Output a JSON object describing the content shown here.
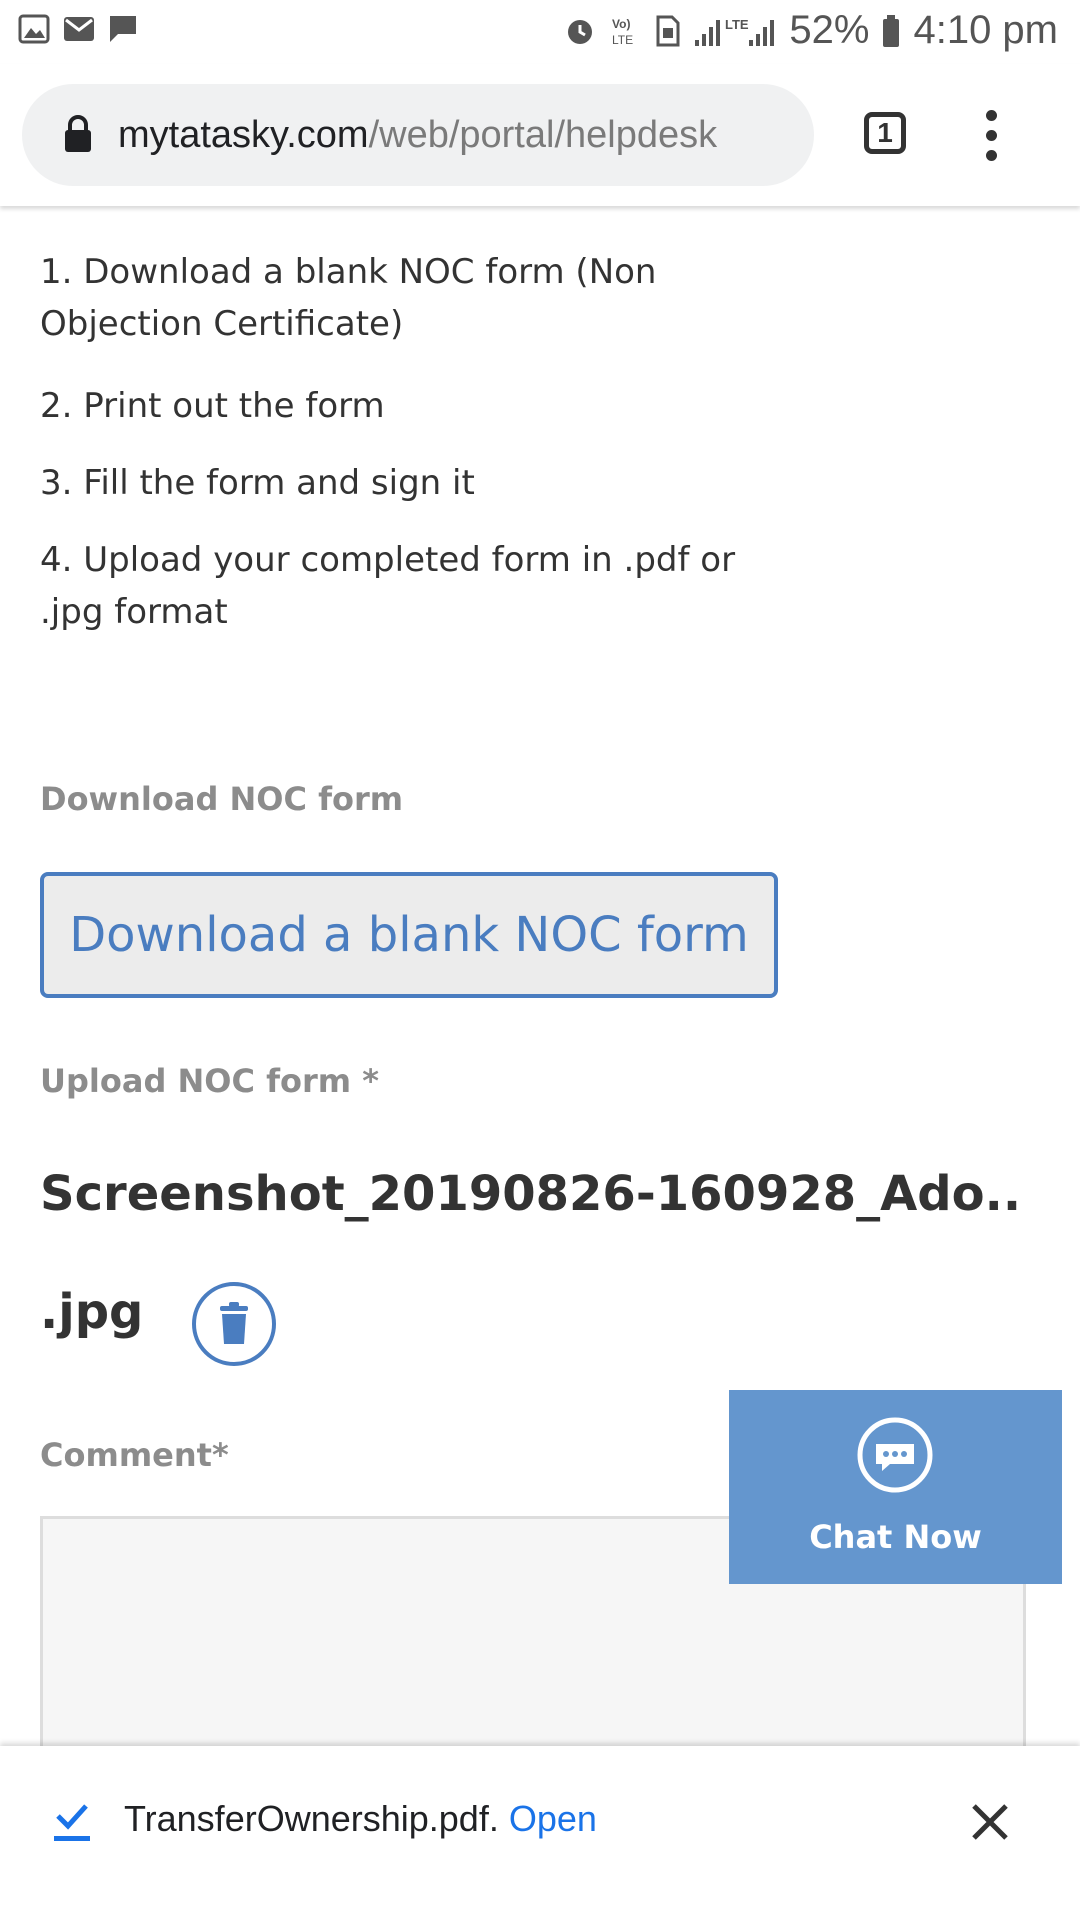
{
  "status_bar": {
    "battery": "52%",
    "time": "4:10 pm",
    "network": "LTE",
    "icons": [
      "image-icon",
      "mail-icon",
      "message-icon",
      "alarm-icon",
      "volte-icon",
      "sim-icon",
      "signal-icon",
      "battery-icon"
    ]
  },
  "browser": {
    "url_domain": "mytatasky.com",
    "url_path": "/web/portal/helpdesk",
    "tab_count": "1"
  },
  "steps": [
    "1. Download a blank NOC form (Non Objection Certificate)",
    "2. Print out the form",
    "3. Fill the form and sign it",
    "4. Upload your completed form in .pdf or .jpg format"
  ],
  "form": {
    "download_label": "Download NOC form",
    "download_button": "Download a blank NOC form",
    "upload_label": "Upload NOC form *",
    "uploaded_filename": "Screenshot_20190826-160928_Ado..",
    "uploaded_ext": ".jpg",
    "comment_label": "Comment*",
    "comment_value": ""
  },
  "chat": {
    "label": "Chat Now"
  },
  "download_bar": {
    "filename": "TransferOwnership.pdf.",
    "open_label": "Open"
  },
  "colors": {
    "accent_blue": "#4a7dc0",
    "chat_blue": "#6496ce",
    "link_blue": "#1a73e8"
  }
}
